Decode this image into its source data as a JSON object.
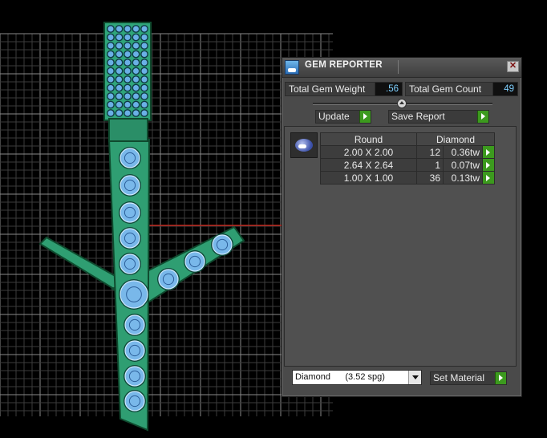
{
  "window": {
    "title": "GEM REPORTER",
    "close_glyph": "✕"
  },
  "totals": {
    "weight_label": "Total Gem Weight",
    "weight_value": ".56",
    "count_label": "Total Gem Count",
    "count_value": "49"
  },
  "actions": {
    "update_label": "Update",
    "save_report_label": "Save Report"
  },
  "gem_table": {
    "header_shape": "Round",
    "header_material": "Diamond",
    "rows": [
      {
        "size": "2.00 X 2.00",
        "count": "12",
        "weight": "0.36tw"
      },
      {
        "size": "2.64 X 2.64",
        "count": "1",
        "weight": "0.07tw"
      },
      {
        "size": "1.00 X 1.00",
        "count": "36",
        "weight": "0.13tw"
      }
    ]
  },
  "material": {
    "selected": "Diamond      (3.52 spg)",
    "set_label": "Set Material"
  },
  "icons": {
    "app": "gem-reporter-app-icon",
    "thumbnail": "round-gem-icon",
    "go": "green-play-arrow-icon"
  },
  "colors": {
    "model_body": "#2f9e72",
    "gem": "#79b8ea",
    "grid": "#8a8a8a",
    "accent_green": "#3c9a1e",
    "value_text": "#7fd0ff"
  }
}
